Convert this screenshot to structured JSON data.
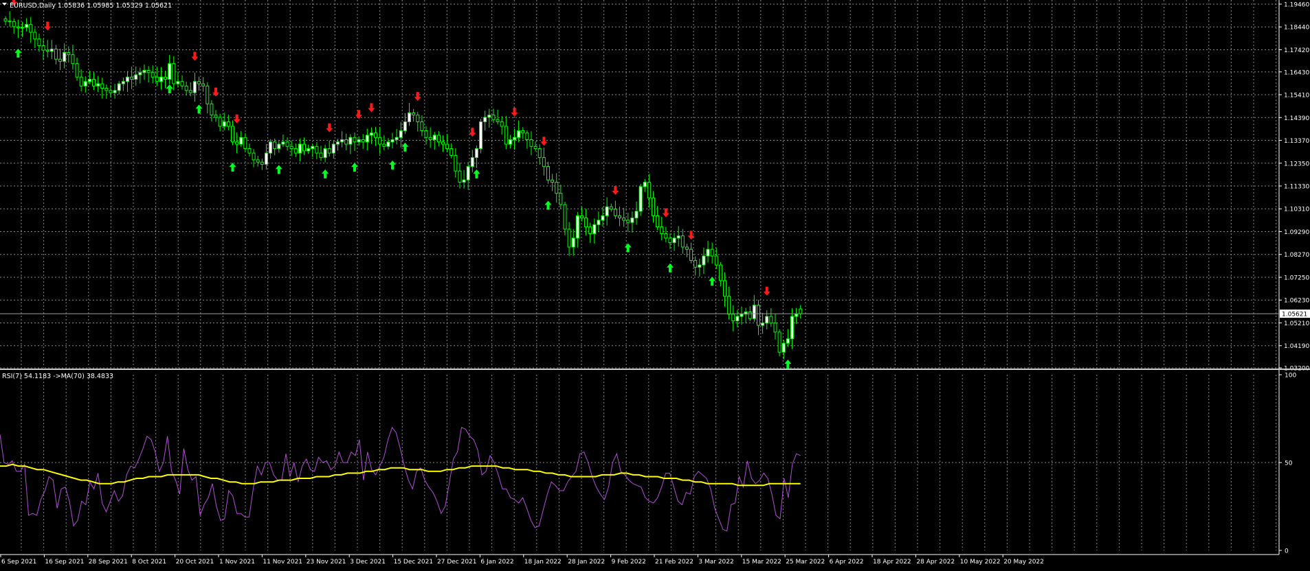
{
  "header": {
    "symbol_text": "EURUSD,Daily  1.05836 1.05985 1.05329 1.05621"
  },
  "indicator_header": {
    "text": "RSI(7) 54.1183  ->MA(70) 38.4833"
  },
  "colors": {
    "background": "#000000",
    "grid": "#8c8c8c",
    "candle": "#00ff00",
    "bull_body": "#ffffff",
    "bear_body": "#000000",
    "up_arrow": "#00ff22",
    "down_arrow": "#ff1a1a",
    "rsi": "#b44fd8",
    "rsi_ma": "#ffff00",
    "text": "#ffffff",
    "price_line": "#9e9e9e"
  },
  "chart_data": [
    {
      "type": "candlestick",
      "symbol": "EURUSD",
      "timeframe": "Daily",
      "open": 1.05836,
      "high": 1.05985,
      "low": 1.05329,
      "close": 1.05621,
      "current_price_label": "1.05621",
      "ylim": [
        1.032,
        1.1946
      ],
      "y_ticks": [
        "1.19460",
        "1.18440",
        "1.17420",
        "1.16430",
        "1.15410",
        "1.14390",
        "1.13370",
        "1.12350",
        "1.11330",
        "1.10310",
        "1.09290",
        "1.08270",
        "1.07250",
        "1.06230",
        "1.05210",
        "1.04190",
        "1.03200"
      ],
      "x_ticks": [
        "6 Sep 2021",
        "16 Sep 2021",
        "28 Sep 2021",
        "8 Oct 2021",
        "20 Oct 2021",
        "1 Nov 2021",
        "11 Nov 2021",
        "23 Nov 2021",
        "3 Dec 2021",
        "15 Dec 2021",
        "27 Dec 2021",
        "6 Jan 2022",
        "18 Jan 2022",
        "28 Jan 2022",
        "9 Feb 2022",
        "21 Feb 2022",
        "3 Mar 2022",
        "15 Mar 2022",
        "25 Mar 2022",
        "6 Apr 2022",
        "18 Apr 2022",
        "28 Apr 2022",
        "10 May 2022",
        "20 May 2022"
      ],
      "close_path": [
        1.187,
        1.1868,
        1.1845,
        1.184,
        1.1842,
        1.1855,
        1.182,
        1.179,
        1.176,
        1.174,
        1.1735,
        1.1745,
        1.17,
        1.169,
        1.173,
        1.172,
        1.168,
        1.162,
        1.158,
        1.16,
        1.161,
        1.158,
        1.159,
        1.157,
        1.156,
        1.155,
        1.156,
        1.159,
        1.16,
        1.162,
        1.161,
        1.163,
        1.164,
        1.165,
        1.164,
        1.162,
        1.16,
        1.162,
        1.161,
        1.168,
        1.159,
        1.16,
        1.158,
        1.156,
        1.155,
        1.16,
        1.159,
        1.158,
        1.15,
        1.145,
        1.144,
        1.14,
        1.142,
        1.14,
        1.133,
        1.132,
        1.135,
        1.13,
        1.128,
        1.125,
        1.124,
        1.123,
        1.128,
        1.133,
        1.13,
        1.132,
        1.133,
        1.131,
        1.13,
        1.128,
        1.132,
        1.129,
        1.13,
        1.131,
        1.128,
        1.126,
        1.13,
        1.128,
        1.132,
        1.133,
        1.134,
        1.132,
        1.135,
        1.133,
        1.134,
        1.133,
        1.136,
        1.137,
        1.135,
        1.132,
        1.131,
        1.133,
        1.134,
        1.135,
        1.138,
        1.142,
        1.146,
        1.145,
        1.142,
        1.138,
        1.135,
        1.134,
        1.136,
        1.133,
        1.132,
        1.13,
        1.127,
        1.12,
        1.115,
        1.116,
        1.122,
        1.126,
        1.13,
        1.142,
        1.144,
        1.145,
        1.143,
        1.142,
        1.14,
        1.132,
        1.134,
        1.135,
        1.138,
        1.137,
        1.134,
        1.131,
        1.13,
        1.126,
        1.122,
        1.116,
        1.115,
        1.11,
        1.105,
        1.094,
        1.086,
        1.09,
        1.1,
        1.099,
        1.095,
        1.092,
        1.096,
        1.098,
        1.1,
        1.104,
        1.103,
        1.1,
        1.099,
        1.098,
        1.097,
        1.099,
        1.102,
        1.113,
        1.115,
        1.108,
        1.1,
        1.095,
        1.092,
        1.09,
        1.088,
        1.09,
        1.091,
        1.086,
        1.085,
        1.08,
        1.077,
        1.078,
        1.082,
        1.085,
        1.082,
        1.078,
        1.071,
        1.064,
        1.056,
        1.053,
        1.055,
        1.056,
        1.057,
        1.054,
        1.06,
        1.051,
        1.052,
        1.055,
        1.052,
        1.048,
        1.039,
        1.043,
        1.045,
        1.055,
        1.056,
        1.0562
      ],
      "up_arrow_positions": [
        3,
        39,
        46,
        54,
        65,
        76,
        83,
        92,
        95,
        112,
        129,
        148,
        158,
        168,
        186,
        191,
        196,
        202
      ],
      "down_arrow_positions": [
        2,
        10,
        45,
        50,
        55,
        77,
        84,
        87,
        98,
        111,
        121,
        128,
        145,
        157,
        163,
        181,
        191,
        195
      ]
    },
    {
      "type": "line",
      "indicator": "RSI(7)",
      "rsi_value": "54.1183",
      "ma_label": "->MA(70)",
      "ma_value": "38.4833",
      "ylim": [
        0,
        100
      ],
      "y_ticks": [
        "100",
        "50",
        "0"
      ],
      "series": [
        {
          "name": "RSI(7)",
          "values": [
            66,
            50,
            49,
            51,
            45,
            45,
            49,
            20,
            21,
            20,
            29,
            34,
            42,
            40,
            24,
            35,
            36,
            28,
            14,
            17,
            28,
            26,
            39,
            35,
            44,
            27,
            22,
            28,
            34,
            28,
            31,
            43,
            48,
            47,
            52,
            58,
            65,
            63,
            56,
            45,
            50,
            65,
            45,
            40,
            32,
            58,
            46,
            40,
            42,
            20,
            26,
            30,
            38,
            25,
            17,
            18,
            34,
            31,
            21,
            21,
            19,
            19,
            35,
            48,
            43,
            50,
            50,
            43,
            40,
            40,
            55,
            42,
            50,
            39,
            48,
            52,
            46,
            45,
            53,
            50,
            51,
            46,
            48,
            56,
            50,
            50,
            56,
            54,
            63,
            40,
            56,
            46,
            43,
            48,
            53,
            63,
            70,
            67,
            58,
            48,
            40,
            35,
            45,
            47,
            40,
            36,
            33,
            28,
            21,
            25,
            38,
            52,
            56,
            70,
            69,
            65,
            63,
            57,
            43,
            45,
            54,
            50,
            43,
            35,
            35,
            30,
            29,
            27,
            30,
            24,
            17,
            13,
            14,
            23,
            32,
            39,
            37,
            34,
            34,
            39,
            42,
            45,
            55,
            56,
            50,
            42,
            36,
            32,
            29,
            36,
            50,
            55,
            45,
            43,
            40,
            38,
            37,
            36,
            30,
            28,
            27,
            30,
            36,
            44,
            44,
            36,
            28,
            26,
            33,
            32,
            42,
            45,
            43,
            41,
            35,
            24,
            18,
            12,
            11,
            26,
            27,
            42,
            36,
            51,
            41,
            38,
            40,
            44,
            41,
            32,
            20,
            18,
            41,
            30,
            49,
            55,
            54
          ],
          "color": "#b44fd8"
        },
        {
          "name": "MA(70)",
          "values": [
            48,
            48,
            49,
            48,
            48,
            47,
            46,
            46,
            45,
            44,
            43,
            42,
            41,
            40,
            40,
            39,
            38,
            38,
            38,
            39,
            39,
            40,
            41,
            41,
            42,
            42,
            42,
            43,
            43,
            43,
            43,
            43,
            43,
            42,
            41,
            41,
            40,
            39,
            39,
            38,
            38,
            38,
            39,
            39,
            39,
            40,
            40,
            40,
            41,
            41,
            41,
            42,
            42,
            42,
            43,
            43,
            44,
            44,
            44,
            45,
            45,
            46,
            46,
            47,
            47,
            47,
            46,
            46,
            46,
            45,
            45,
            45,
            46,
            46,
            47,
            47,
            48,
            48,
            48,
            48,
            48,
            47,
            47,
            46,
            46,
            46,
            45,
            45,
            44,
            44,
            43,
            43,
            42,
            42,
            42,
            42,
            42,
            43,
            43,
            43,
            44,
            44,
            43,
            43,
            42,
            42,
            42,
            41,
            41,
            41,
            40,
            40,
            39,
            39,
            38,
            38,
            38,
            38,
            38,
            37,
            37,
            37,
            37,
            37,
            38,
            38,
            38,
            38,
            38,
            38
          ],
          "color": "#ffff00"
        }
      ]
    }
  ]
}
